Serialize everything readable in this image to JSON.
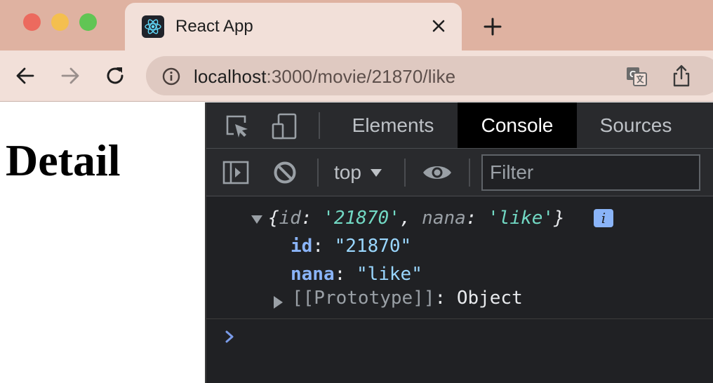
{
  "window": {
    "tab_title": "React App",
    "tab_favicon": "react-logo-icon",
    "url_host": "localhost",
    "url_path": ":3000/movie/21870/like",
    "nav_icons": [
      "back-arrow-icon",
      "forward-arrow-icon",
      "reload-icon"
    ],
    "colors": {
      "tabstrip": "#dfb2a1",
      "active_tab": "#f2e0d9",
      "omnibox": "#dfc9c1"
    }
  },
  "page": {
    "heading": "Detail"
  },
  "devtools": {
    "tabs": [
      "Elements",
      "Console",
      "Sources"
    ],
    "active_tab": "Console",
    "context": "top",
    "filter_placeholder": "Filter",
    "console": {
      "summary_open": "{",
      "summary_k1": "id",
      "summary_colon1": ": ",
      "summary_v1": "'21870'",
      "summary_comma": ", ",
      "summary_k2": "nana",
      "summary_colon2": ": ",
      "summary_v2": "'like'",
      "summary_close": "}",
      "info_badge": "i",
      "props": [
        {
          "key": "id",
          "value": "\"21870\""
        },
        {
          "key": "nana",
          "value": "\"like\""
        }
      ],
      "prototype_key": "[[Prototype]]",
      "prototype_sep": ": ",
      "prototype_value": "Object"
    },
    "colors": {
      "background": "#202124",
      "toolbar": "#292a2d",
      "active_tab": "#000000",
      "string": "#72d9c4",
      "key": "#8ab4f8"
    }
  }
}
